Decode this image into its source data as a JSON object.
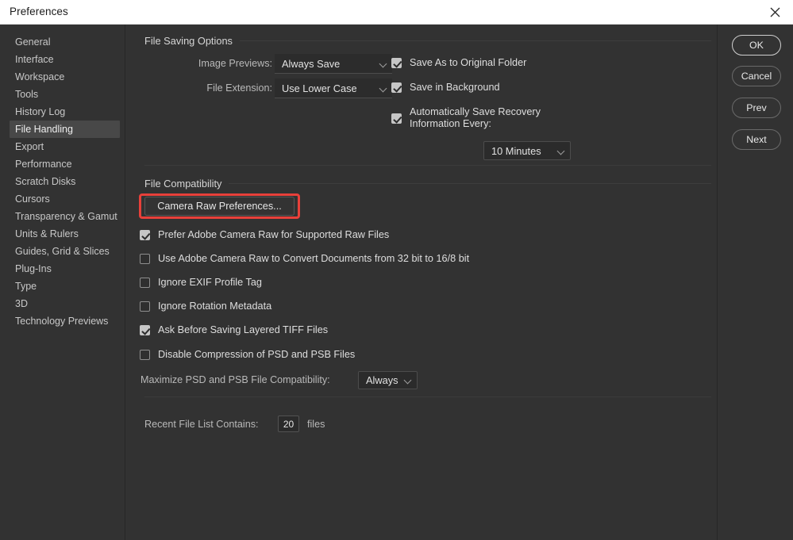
{
  "window": {
    "title": "Preferences",
    "close_icon": "close-icon"
  },
  "sidebar": {
    "items": [
      {
        "label": "General",
        "active": false
      },
      {
        "label": "Interface",
        "active": false
      },
      {
        "label": "Workspace",
        "active": false
      },
      {
        "label": "Tools",
        "active": false
      },
      {
        "label": "History Log",
        "active": false
      },
      {
        "label": "File Handling",
        "active": true
      },
      {
        "label": "Export",
        "active": false
      },
      {
        "label": "Performance",
        "active": false
      },
      {
        "label": "Scratch Disks",
        "active": false
      },
      {
        "label": "Cursors",
        "active": false
      },
      {
        "label": "Transparency & Gamut",
        "active": false
      },
      {
        "label": "Units & Rulers",
        "active": false
      },
      {
        "label": "Guides, Grid & Slices",
        "active": false
      },
      {
        "label": "Plug-Ins",
        "active": false
      },
      {
        "label": "Type",
        "active": false
      },
      {
        "label": "3D",
        "active": false
      },
      {
        "label": "Technology Previews",
        "active": false
      }
    ]
  },
  "file_saving_options": {
    "section_title": "File Saving Options",
    "image_previews_label": "Image Previews:",
    "image_previews_value": "Always Save",
    "file_extension_label": "File Extension:",
    "file_extension_value": "Use Lower Case",
    "save_as_original_label": "Save As to Original Folder",
    "save_as_original_checked": true,
    "save_in_background_label": "Save in Background",
    "save_in_background_checked": true,
    "auto_save_recovery_label": "Automatically Save Recovery\nInformation Every:",
    "auto_save_recovery_checked": true,
    "recovery_interval_value": "10 Minutes"
  },
  "file_compatibility": {
    "section_title": "File Compatibility",
    "camera_raw_button": "Camera Raw Preferences...",
    "checkboxes": [
      {
        "label": "Prefer Adobe Camera Raw for Supported Raw Files",
        "checked": true
      },
      {
        "label": "Use Adobe Camera Raw to Convert Documents from 32 bit to 16/8 bit",
        "checked": false
      },
      {
        "label": "Ignore EXIF Profile Tag",
        "checked": false
      },
      {
        "label": "Ignore Rotation Metadata",
        "checked": false
      },
      {
        "label": "Ask Before Saving Layered TIFF Files",
        "checked": true
      },
      {
        "label": "Disable Compression of PSD and PSB Files",
        "checked": false
      }
    ],
    "maximize_label": "Maximize PSD and PSB File Compatibility:",
    "maximize_value": "Always"
  },
  "recent_files": {
    "label": "Recent File List Contains:",
    "value": "20",
    "suffix": "files"
  },
  "buttons": {
    "ok": "OK",
    "cancel": "Cancel",
    "prev": "Prev",
    "next": "Next"
  },
  "colors": {
    "dialog_bg": "#323232",
    "titlebar_bg": "#ffffff",
    "accent_annotation": "#e8403a",
    "active_item_bg": "#484848"
  }
}
